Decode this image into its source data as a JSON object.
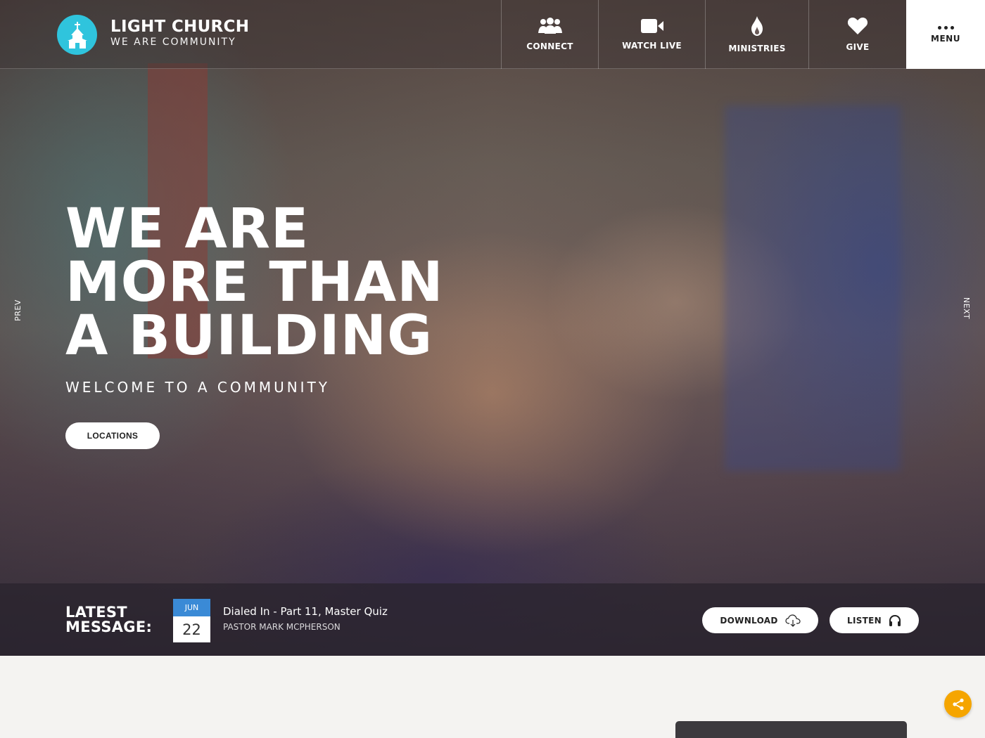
{
  "brand": {
    "title": "LIGHT CHURCH",
    "tagline": "WE ARE COMMUNITY",
    "logo_icon": "church-icon",
    "accent_color": "#2fc4dd"
  },
  "nav": {
    "items": [
      {
        "label": "CONNECT",
        "icon": "people-icon"
      },
      {
        "label": "WATCH LIVE",
        "icon": "video-camera-icon"
      },
      {
        "label": "MINISTRIES",
        "icon": "flame-icon"
      },
      {
        "label": "GIVE",
        "icon": "heart-icon"
      }
    ],
    "menu_label": "MENU"
  },
  "slider": {
    "prev_label": "PREV",
    "next_label": "NEXT"
  },
  "hero": {
    "headline_lines": [
      "WE ARE",
      "MORE THAN",
      "A BUILDING"
    ],
    "subtitle": "WELCOME TO A COMMUNITY",
    "cta_label": "LOCATIONS"
  },
  "latest_message": {
    "label_line1": "LATEST",
    "label_line2": "MESSAGE:",
    "month": "JUN",
    "day": "22",
    "title": "Dialed In - Part 11, Master Quiz",
    "pastor": "PASTOR MARK MCPHERSON",
    "download_label": "DOWNLOAD",
    "listen_label": "LISTEN",
    "date_color": "#3a8ad6"
  },
  "share": {
    "icon": "share-icon",
    "color": "#f5a500"
  }
}
